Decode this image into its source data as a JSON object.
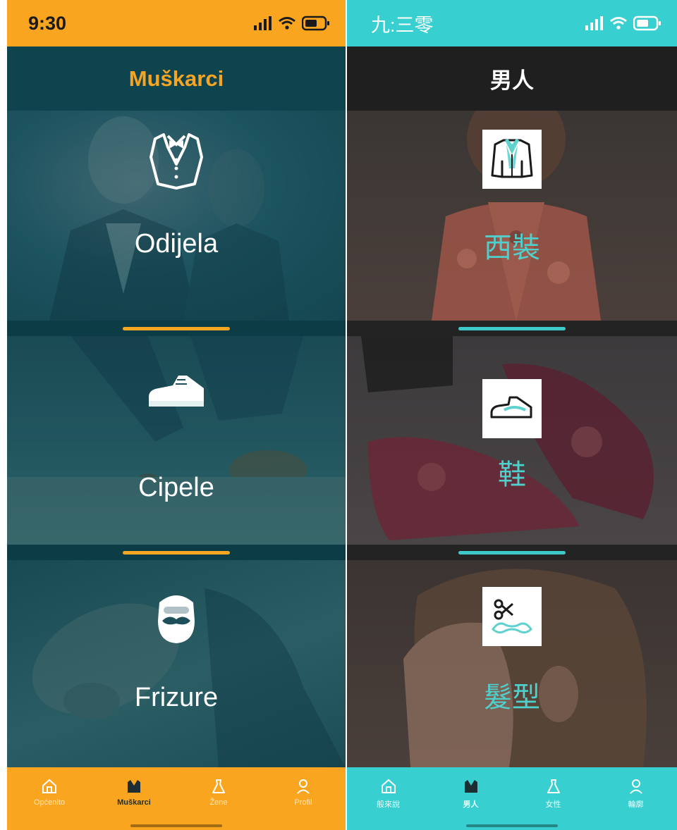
{
  "left": {
    "status_time": "9:30",
    "header_title": "Muškarci",
    "categories": [
      {
        "label": "Odijela",
        "icon": "tuxedo-icon"
      },
      {
        "label": "Cipele",
        "icon": "shoe-icon"
      },
      {
        "label": "Frizure",
        "icon": "beard-icon"
      }
    ],
    "tabs": [
      {
        "label": "Općenito",
        "icon": "home-icon",
        "active": false
      },
      {
        "label": "Muškarci",
        "icon": "jacket-icon",
        "active": true
      },
      {
        "label": "Žene",
        "icon": "dress-icon",
        "active": false
      },
      {
        "label": "Profil",
        "icon": "person-icon",
        "active": false
      }
    ],
    "accent": "#f9a51f",
    "header_color": "#0e444d"
  },
  "right": {
    "status_time": "九:三零",
    "header_title": "男人",
    "categories": [
      {
        "label": "西裝",
        "icon": "suit-jacket-icon"
      },
      {
        "label": "鞋",
        "icon": "shoe-icon"
      },
      {
        "label": "髮型",
        "icon": "scissors-mustache-icon"
      }
    ],
    "tabs": [
      {
        "label": "般來說",
        "icon": "home-icon",
        "active": false
      },
      {
        "label": "男人",
        "icon": "jacket-icon",
        "active": true
      },
      {
        "label": "女性",
        "icon": "dress-icon",
        "active": false
      },
      {
        "label": "輪廓",
        "icon": "person-icon",
        "active": false
      }
    ],
    "accent": "#37cfcf",
    "header_color": "#1f1f1f"
  }
}
